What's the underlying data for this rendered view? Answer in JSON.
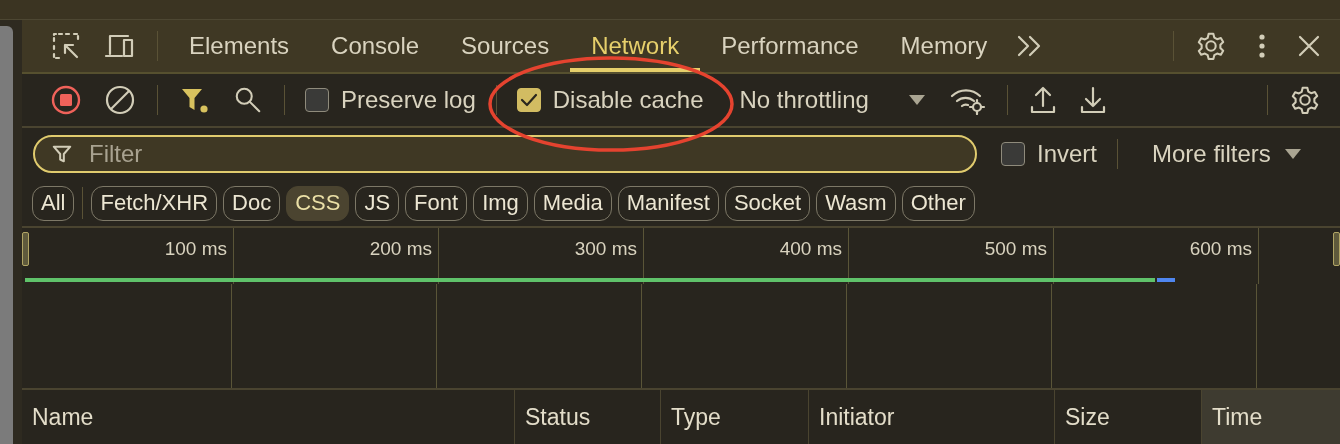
{
  "tabs": [
    {
      "label": "Elements",
      "selected": false
    },
    {
      "label": "Console",
      "selected": false
    },
    {
      "label": "Sources",
      "selected": false
    },
    {
      "label": "Network",
      "selected": true
    },
    {
      "label": "Performance",
      "selected": false
    },
    {
      "label": "Memory",
      "selected": false
    }
  ],
  "toolbar": {
    "preserve_log": {
      "label": "Preserve log",
      "checked": false
    },
    "disable_cache": {
      "label": "Disable cache",
      "checked": true
    },
    "throttling": {
      "value": "No throttling"
    }
  },
  "filter": {
    "placeholder": "Filter"
  },
  "invert": {
    "label": "Invert",
    "checked": false
  },
  "more_filters": "More filters",
  "chips": [
    {
      "label": "All",
      "selected": false
    },
    {
      "label": "Fetch/XHR",
      "selected": false
    },
    {
      "label": "Doc",
      "selected": false
    },
    {
      "label": "CSS",
      "selected": true
    },
    {
      "label": "JS",
      "selected": false
    },
    {
      "label": "Font",
      "selected": false
    },
    {
      "label": "Img",
      "selected": false
    },
    {
      "label": "Media",
      "selected": false
    },
    {
      "label": "Manifest",
      "selected": false
    },
    {
      "label": "Socket",
      "selected": false
    },
    {
      "label": "Wasm",
      "selected": false
    },
    {
      "label": "Other",
      "selected": false
    }
  ],
  "timeline": {
    "ticks": [
      "100 ms",
      "200 ms",
      "300 ms",
      "400 ms",
      "500 ms",
      "600 ms"
    ]
  },
  "columns": [
    {
      "label": "Name",
      "selected": false
    },
    {
      "label": "Status",
      "selected": false
    },
    {
      "label": "Type",
      "selected": false
    },
    {
      "label": "Initiator",
      "selected": false
    },
    {
      "label": "Size",
      "selected": false
    },
    {
      "label": "Time",
      "selected": true
    }
  ]
}
